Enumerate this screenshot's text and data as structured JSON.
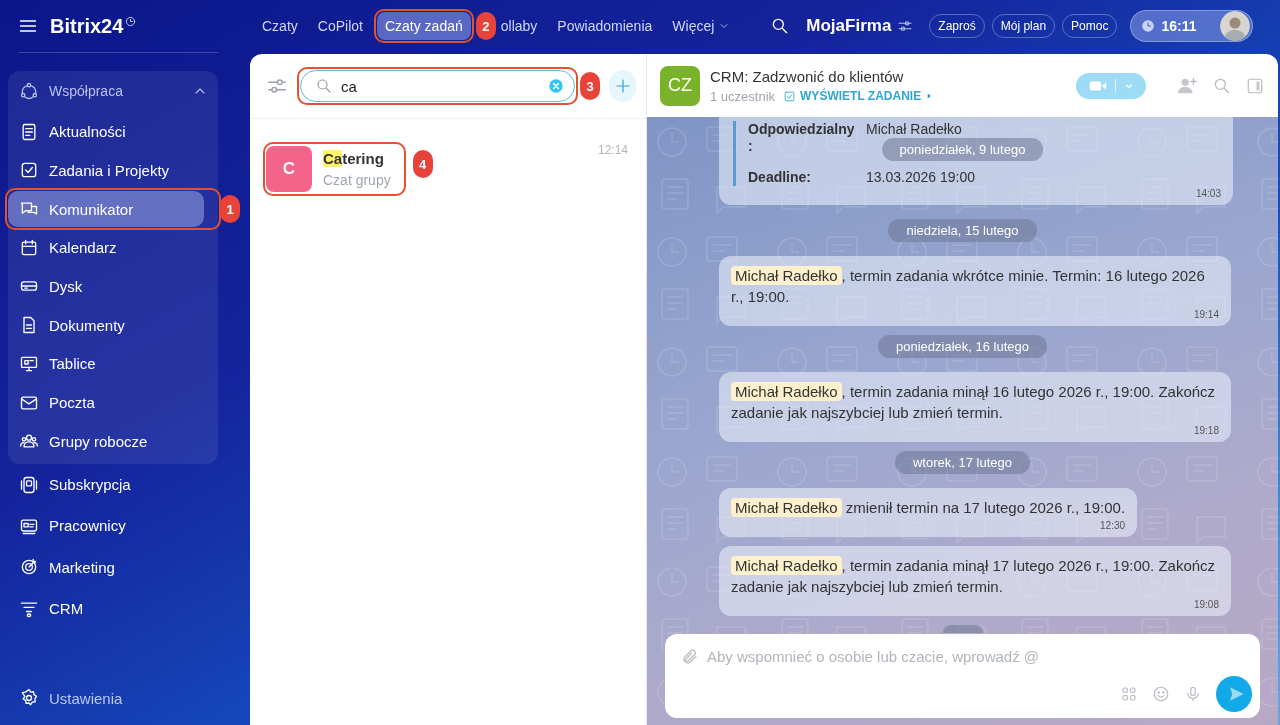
{
  "sidebar": {
    "logo": "Bitrix24",
    "group": {
      "label": "Współpraca",
      "expanded": true,
      "items": [
        {
          "label": "Aktualności",
          "selected": false
        },
        {
          "label": "Zadania i Projekty",
          "selected": false
        },
        {
          "label": "Komunikator",
          "selected": true,
          "annotation": "1"
        },
        {
          "label": "Kalendarz",
          "selected": false
        },
        {
          "label": "Dysk",
          "selected": false
        },
        {
          "label": "Dokumenty",
          "selected": false
        },
        {
          "label": "Tablice",
          "selected": false
        },
        {
          "label": "Poczta",
          "selected": false
        },
        {
          "label": "Grupy robocze",
          "selected": false
        }
      ]
    },
    "items": [
      {
        "label": "Subskrypcja",
        "selected": false
      },
      {
        "label": "Pracownicy",
        "selected": false
      },
      {
        "label": "Marketing",
        "selected": false
      },
      {
        "label": "CRM",
        "selected": false
      }
    ],
    "settings": "Ustawienia"
  },
  "topbar": {
    "tabs": [
      {
        "label": "Czaty",
        "selected": false
      },
      {
        "label": "CoPilot",
        "selected": false
      },
      {
        "label": "Czaty zadań",
        "selected": true,
        "annotation": "2"
      },
      {
        "label": "ollaby",
        "selected": false
      },
      {
        "label": "Powiadomienia",
        "selected": false
      },
      {
        "label": "Więcej",
        "selected": false,
        "dropdown": true
      }
    ],
    "company": "MojaFirma",
    "buttons": [
      "Zaproś",
      "Mój plan",
      "Pomoc"
    ],
    "clock": "16:11"
  },
  "chat_list": {
    "search": {
      "value": "ca",
      "annotation": "3"
    },
    "chats": [
      {
        "avatar": "C",
        "color": "#f4648a",
        "title_match": "Ca",
        "title_rest": "tering",
        "subtitle": "Czat grupy",
        "time": "12:14",
        "annotation": "4"
      }
    ]
  },
  "chat": {
    "avatar": "CZ",
    "title": "CRM: Zadzwonić do klientów",
    "members": "1 uczestnik",
    "task_link": "WYŚWIETL ZADANIE",
    "video_button": {
      "disabled": true
    },
    "sticky_date": "poniedziałek, 9 lutego",
    "messages": [
      {
        "kind": "task-card",
        "fields": [
          {
            "label": "Odpowiedzialny :",
            "value": "Michał Radełko"
          },
          {
            "label": "Deadline:",
            "value": "13.03.2026 19:00"
          }
        ],
        "time": "14:03"
      },
      {
        "kind": "date",
        "text": "niedziela, 15 lutego"
      },
      {
        "kind": "mention",
        "mention": "Michał Radełko",
        "text": ", termin zadania wkrótce minie. Termin: 16 lutego 2026 r., 19:00.",
        "time": "19:14"
      },
      {
        "kind": "date",
        "text": "poniedziałek, 16 lutego"
      },
      {
        "kind": "mention",
        "mention": "Michał Radełko",
        "text": ", termin zadania minął 16 lutego 2026 r., 19:00. Zakończ zadanie jak najszybciej lub zmień termin.",
        "time": "19:18"
      },
      {
        "kind": "date",
        "text": "wtorek, 17 lutego"
      },
      {
        "kind": "mention",
        "mention": "Michał Radełko",
        "text": " zmienił termin na 17 lutego 2026 r., 19:00.",
        "time": "12:30"
      },
      {
        "kind": "mention",
        "mention": "Michał Radełko",
        "text": ", termin zadania minął 17 lutego 2026 r., 19:00. Zakończ zadanie jak najszybciej lub zmień termin.",
        "time": "19:08"
      },
      {
        "kind": "date-cut"
      }
    ],
    "composer": {
      "placeholder": "Aby wspomnieć o osobie lub czacie, wprowadź @"
    }
  }
}
